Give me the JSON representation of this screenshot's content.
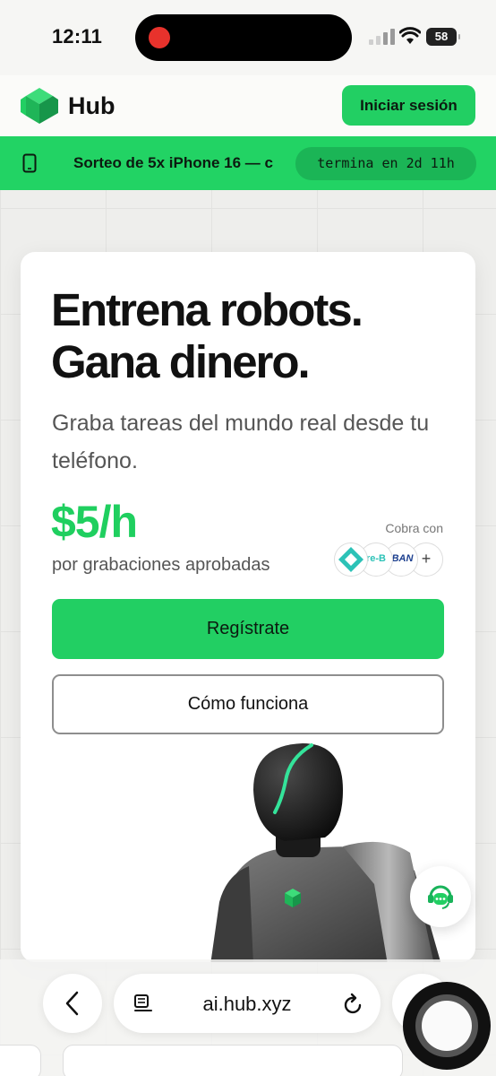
{
  "status_bar": {
    "time": "12:11",
    "battery": "58",
    "icons": [
      "recording-dot",
      "cellular-signal-icon",
      "wifi-icon",
      "battery-icon"
    ]
  },
  "header": {
    "logo_text": "Hub",
    "login_label": "Iniciar sesión",
    "icon": "hub-logo-icon"
  },
  "promo": {
    "icon": "phone-icon",
    "text": "Sorteo de 5x iPhone 16 — c",
    "timer": "termina en 2d 11h"
  },
  "hero": {
    "headline_line1": "Entrena robots.",
    "headline_line2": "Gana dinero.",
    "subtitle": "Graba tareas del mundo real desde tu teléfono.",
    "price": "$5/h",
    "price_caption": "por grabaciones aprobadas",
    "pay_label": "Cobra con",
    "pay_methods": [
      "",
      "re-B",
      "IBAN",
      "+"
    ],
    "register_label": "Regístrate",
    "how_label": "Cómo funciona"
  },
  "browser": {
    "url": "ai.hub.xyz",
    "icons": [
      "back-icon",
      "reader-icon",
      "reload-icon"
    ]
  },
  "colors": {
    "accent": "#22cf63",
    "price": "#1fcf5f",
    "robot_glow": "#34e39a"
  }
}
